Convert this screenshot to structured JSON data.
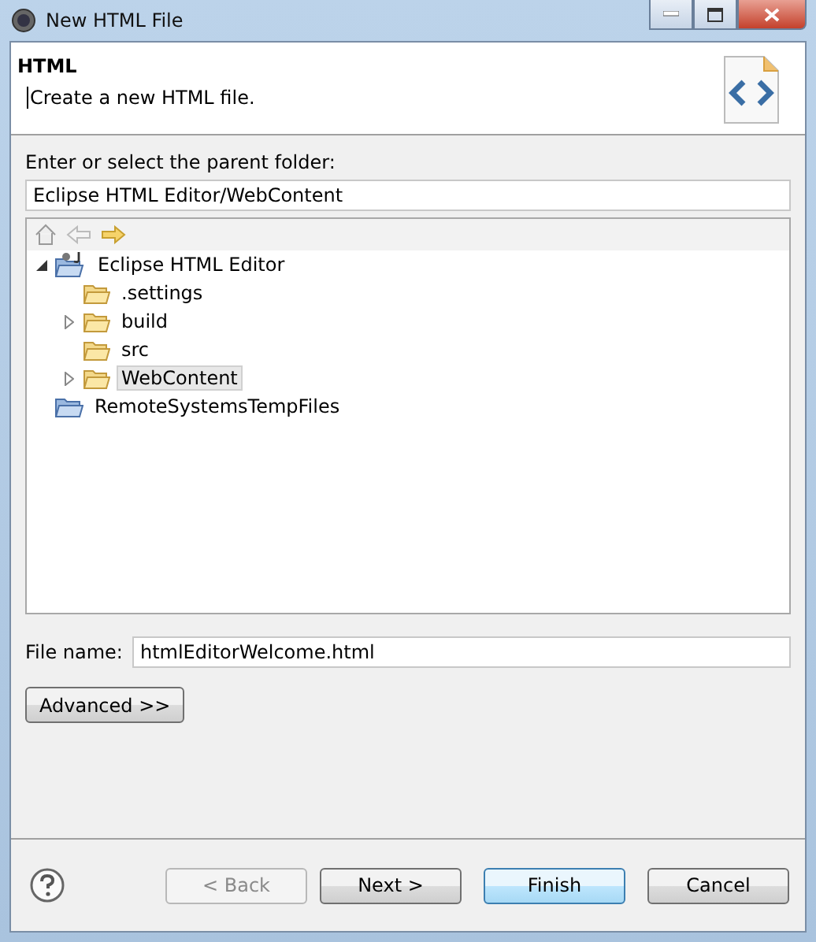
{
  "window": {
    "title": "New HTML File"
  },
  "header": {
    "title": "HTML",
    "message": "Create a new HTML file."
  },
  "folder_label": "Enter or select the parent folder:",
  "folder_field": {
    "value": "Eclipse HTML Editor/WebContent"
  },
  "tree": [
    {
      "label": "Eclipse HTML Editor",
      "kind": "project",
      "expandable": true,
      "expanded": true,
      "selected": false,
      "children": [
        {
          "label": ".settings",
          "kind": "folder",
          "expandable": false,
          "selected": false
        },
        {
          "label": "build",
          "kind": "folder",
          "expandable": true,
          "expanded": false,
          "selected": false
        },
        {
          "label": "src",
          "kind": "folder",
          "expandable": false,
          "selected": false
        },
        {
          "label": "WebContent",
          "kind": "folder",
          "expandable": true,
          "expanded": false,
          "selected": true
        }
      ]
    },
    {
      "label": "RemoteSystemsTempFiles",
      "kind": "project-plain",
      "expandable": false,
      "selected": false
    }
  ],
  "file_name": {
    "label": "File name:",
    "value": "htmlEditorWelcome.html"
  },
  "advanced_button": "Advanced >>",
  "buttons": [
    {
      "label": "< Back",
      "disabled": true,
      "default": false
    },
    {
      "label": "Next >",
      "disabled": false,
      "default": false
    },
    {
      "label": "Finish",
      "disabled": false,
      "default": true
    },
    {
      "label": "Cancel",
      "disabled": false,
      "default": false
    }
  ]
}
